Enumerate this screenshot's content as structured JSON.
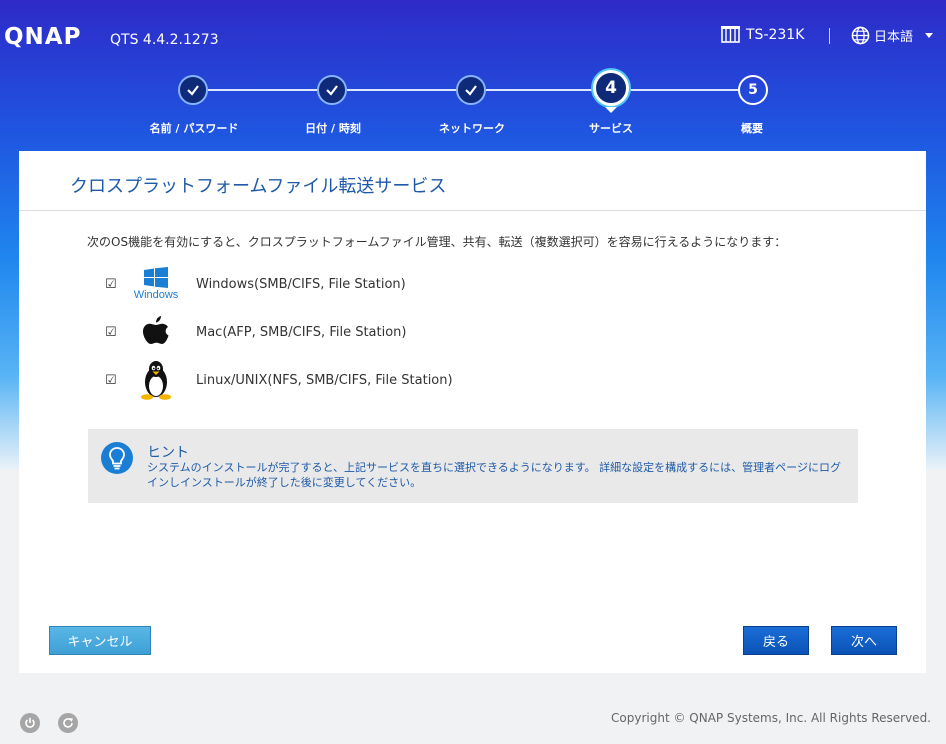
{
  "header": {
    "logo": "QNAP",
    "version": "QTS 4.4.2.1273",
    "model": "TS-231K",
    "language": "日本語",
    "model_icon": "server-icon",
    "language_icon": "globe-icon"
  },
  "steps": [
    {
      "number": "1",
      "label": "名前 / パスワード",
      "state": "done"
    },
    {
      "number": "2",
      "label": "日付 / 時刻",
      "state": "done"
    },
    {
      "number": "3",
      "label": "ネットワーク",
      "state": "done"
    },
    {
      "number": "4",
      "label": "サービス",
      "state": "current"
    },
    {
      "number": "5",
      "label": "概要",
      "state": "future"
    }
  ],
  "panel": {
    "title": "クロスプラットフォームファイル転送サービス",
    "intro": "次のOS機能を有効にすると、クロスプラットフォームファイル管理、共有、転送（複数選択可）を容易に行えるようになります：",
    "services": [
      {
        "checkbox": "☑",
        "logo": "windows-logo-icon",
        "logo_text": "Windows",
        "label": "Windows(SMB/CIFS, File Station)",
        "checked": true
      },
      {
        "checkbox": "☑",
        "logo": "apple-logo-icon",
        "label": "Mac(AFP, SMB/CIFS, File Station)",
        "checked": true
      },
      {
        "checkbox": "☑",
        "logo": "linux-tux-icon",
        "label": "Linux/UNIX(NFS, SMB/CIFS, File Station)",
        "checked": true
      }
    ],
    "hint": {
      "title": "ヒント",
      "text": "システムのインストールが完了すると、上記サービスを直ちに選択できるようになります。 詳細な設定を構成するには、管理者ページにログインしインストールが終了した後に変更してください。"
    }
  },
  "buttons": {
    "cancel": "キャンセル",
    "back": "戻る",
    "next": "次へ"
  },
  "footer": {
    "copyright": "Copyright © QNAP Systems, Inc. All Rights Reserved."
  },
  "colors": {
    "accent": "#1e5aa8",
    "primary_button": "#0b52b5",
    "cancel_button": "#3e9fd5"
  }
}
